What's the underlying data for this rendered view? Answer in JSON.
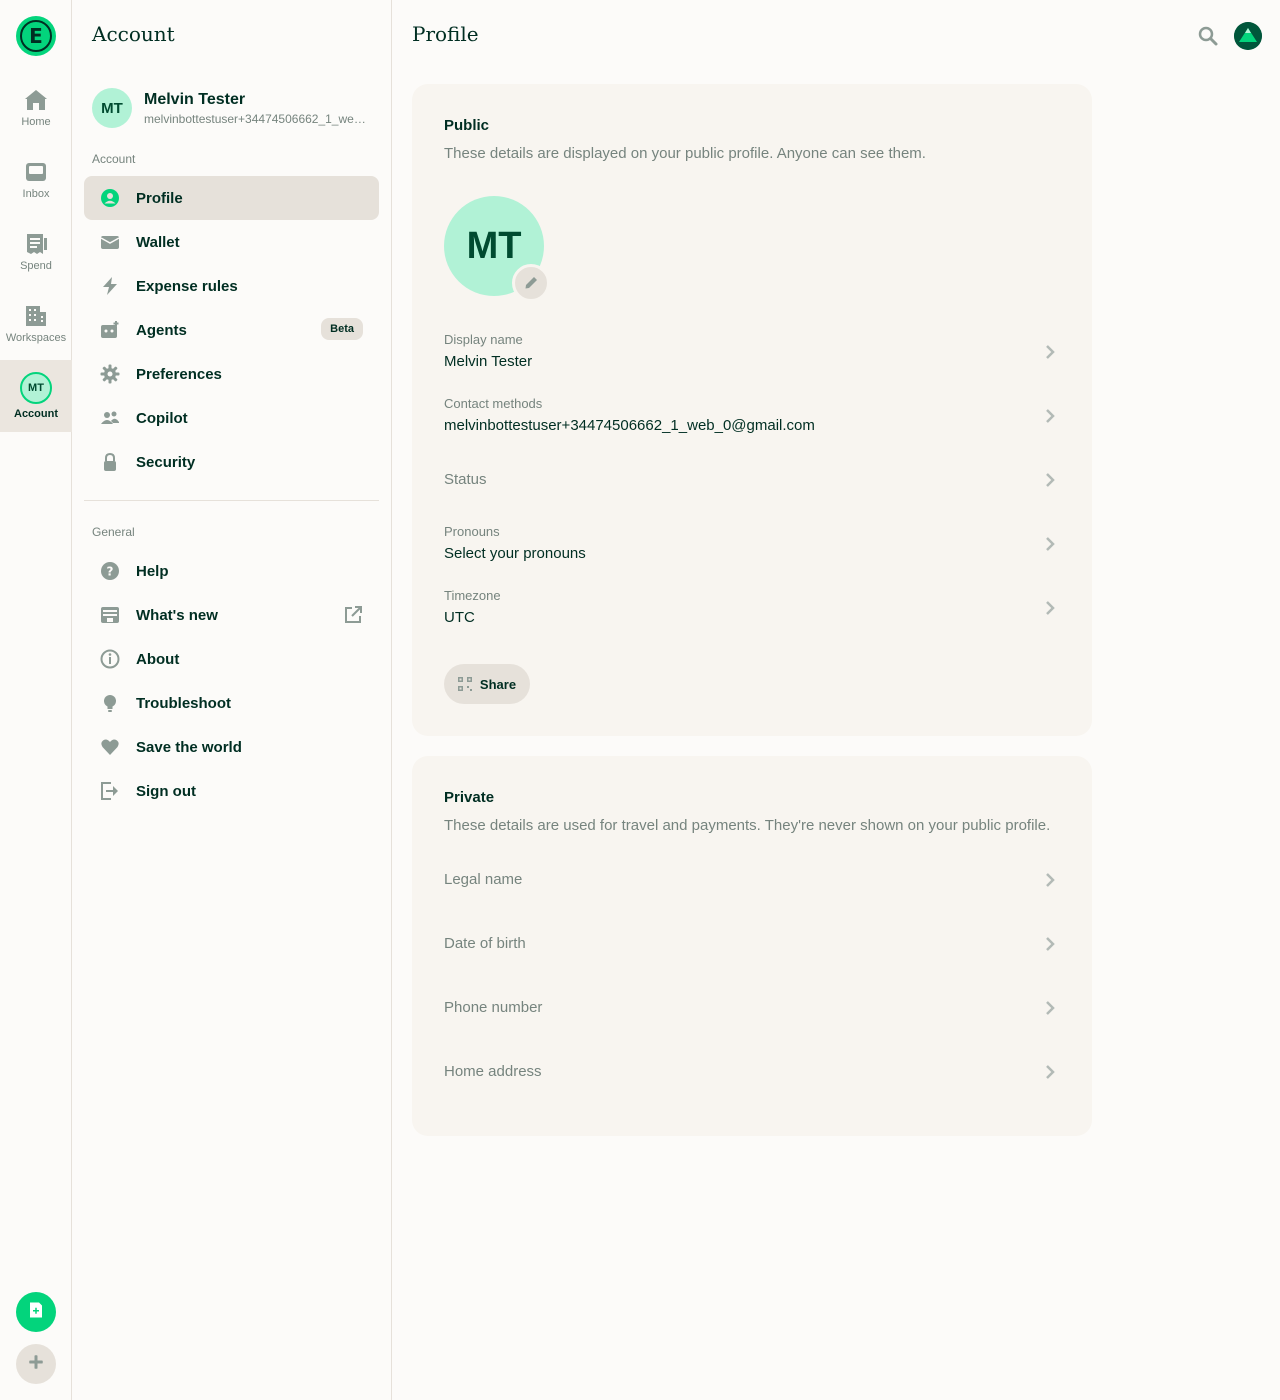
{
  "rail": {
    "logo_letter": "E",
    "items": [
      {
        "label": "Home",
        "icon": "home-icon"
      },
      {
        "label": "Inbox",
        "icon": "inbox-icon"
      },
      {
        "label": "Spend",
        "icon": "receipt-icon"
      },
      {
        "label": "Workspaces",
        "icon": "building-icon"
      },
      {
        "label": "Account",
        "avatar_initials": "MT"
      }
    ]
  },
  "settings": {
    "title": "Account",
    "user": {
      "initials": "MT",
      "name": "Melvin Tester",
      "email": "melvinbottestuser+34474506662_1_web_0@gmail.com"
    },
    "account_section_label": "Account",
    "account_items": [
      {
        "label": "Profile",
        "icon": "profile-icon",
        "active": true
      },
      {
        "label": "Wallet",
        "icon": "wallet-icon"
      },
      {
        "label": "Expense rules",
        "icon": "lightning-icon"
      },
      {
        "label": "Agents",
        "icon": "agent-icon",
        "badge": "Beta"
      },
      {
        "label": "Preferences",
        "icon": "gear-icon"
      },
      {
        "label": "Copilot",
        "icon": "users-icon"
      },
      {
        "label": "Security",
        "icon": "lock-icon"
      }
    ],
    "general_section_label": "General",
    "general_items": [
      {
        "label": "Help",
        "icon": "question-icon"
      },
      {
        "label": "What's new",
        "icon": "news-icon",
        "external": true
      },
      {
        "label": "About",
        "icon": "info-icon"
      },
      {
        "label": "Troubleshoot",
        "icon": "lightbulb-icon"
      },
      {
        "label": "Save the world",
        "icon": "heart-icon"
      },
      {
        "label": "Sign out",
        "icon": "sign-out-icon"
      }
    ]
  },
  "main": {
    "title": "Profile",
    "public": {
      "heading": "Public",
      "subtitle": "These details are displayed on your public profile. Anyone can see them.",
      "avatar_initials": "MT",
      "rows": [
        {
          "label": "Display name",
          "value": "Melvin Tester"
        },
        {
          "label": "Contact methods",
          "value": "melvinbottestuser+34474506662_1_web_0@gmail.com"
        },
        {
          "placeholder": "Status"
        },
        {
          "label": "Pronouns",
          "value": "Select your pronouns"
        },
        {
          "label": "Timezone",
          "value": "UTC"
        }
      ],
      "share_label": "Share"
    },
    "private": {
      "heading": "Private",
      "subtitle": "These details are used for travel and payments. They're never shown on your public profile.",
      "rows": [
        "Legal name",
        "Date of birth",
        "Phone number",
        "Home address"
      ]
    }
  },
  "colors": {
    "brand_green": "#03d47c",
    "dark_green": "#002e22",
    "muted_text": "#76847e",
    "card_bg": "#f8f5f0",
    "mint": "#b1f2d6"
  }
}
